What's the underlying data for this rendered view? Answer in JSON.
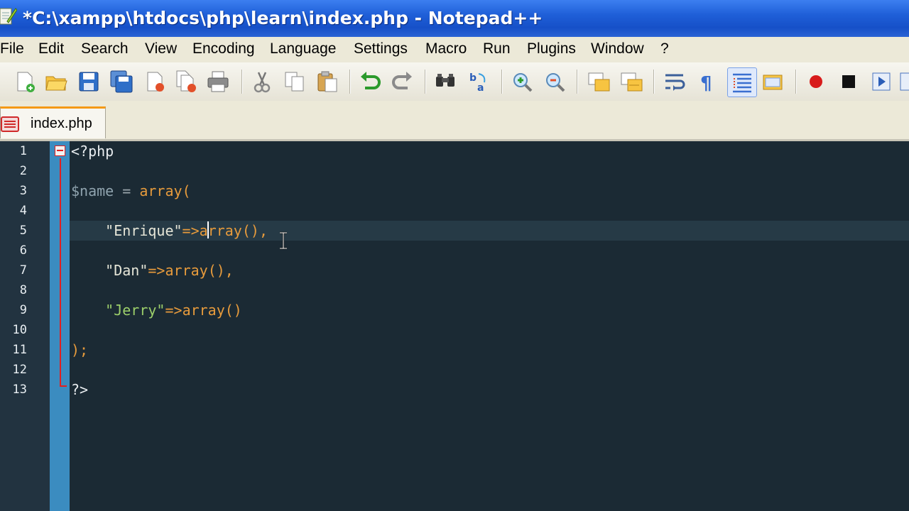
{
  "window": {
    "title": "*C:\\xampp\\htdocs\\php\\learn\\index.php - Notepad++"
  },
  "menu": {
    "items": [
      "File",
      "Edit",
      "Search",
      "View",
      "Encoding",
      "Language",
      "Settings",
      "Macro",
      "Run",
      "Plugins",
      "Window",
      "?"
    ]
  },
  "toolbar": {
    "icons": [
      "new-file-icon",
      "open-file-icon",
      "save-icon",
      "save-all-icon",
      "close-icon",
      "close-all-icon",
      "print-icon",
      "cut-icon",
      "copy-icon",
      "paste-icon",
      "undo-icon",
      "redo-icon",
      "find-icon",
      "replace-icon",
      "zoom-in-icon",
      "zoom-out-icon",
      "sync-vertical-icon",
      "sync-horizontal-icon",
      "word-wrap-icon",
      "show-all-chars-icon",
      "indent-guide-icon",
      "folder-as-workspace-icon",
      "record-macro-icon",
      "stop-record-icon",
      "play-macro-icon"
    ]
  },
  "tabs": [
    {
      "label": "index.php",
      "active": true,
      "modified": true
    }
  ],
  "editor": {
    "line_numbers": [
      "1",
      "2",
      "3",
      "4",
      "5",
      "6",
      "7",
      "8",
      "9",
      "10",
      "11",
      "12",
      "13"
    ],
    "current_line": 5,
    "lines": {
      "l1": {
        "open_tag": "<?php"
      },
      "l3": {
        "var": "$name",
        "eq": " = ",
        "fn": "array("
      },
      "l5": {
        "key": "\"Enrique\"",
        "arrow": "=>",
        "fn_a": "a",
        "fn_rest": "rray(",
        "close": ")",
        "comma": ","
      },
      "l7": {
        "key": "\"Dan\"",
        "arrow": "=>",
        "fn": "array()",
        "comma": ","
      },
      "l9": {
        "key": "\"Jerry\"",
        "arrow": "=>",
        "fn": "array()"
      },
      "l11": {
        "close": ");"
      },
      "l13": {
        "close_tag": "?>"
      }
    }
  },
  "colors": {
    "editor_bg": "#1b2a34",
    "fold_margin": "#3b8cc0",
    "tab_accent": "#f59a16",
    "fold_line": "#e02020"
  }
}
